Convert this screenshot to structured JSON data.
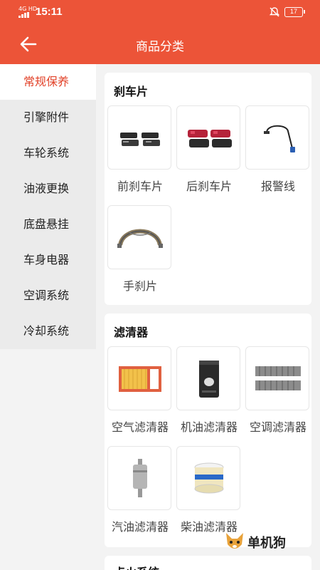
{
  "status_bar": {
    "network": "4G HD",
    "time": "15:11",
    "battery": "17"
  },
  "header": {
    "title": "商品分类",
    "back_icon": "arrow-left-icon"
  },
  "sidebar": {
    "items": [
      {
        "label": "常规保养",
        "active": true
      },
      {
        "label": "引擎附件",
        "active": false
      },
      {
        "label": "车轮系统",
        "active": false
      },
      {
        "label": "油液更换",
        "active": false
      },
      {
        "label": "底盘悬挂",
        "active": false
      },
      {
        "label": "车身电器",
        "active": false
      },
      {
        "label": "空调系统",
        "active": false
      },
      {
        "label": "冷却系统",
        "active": false
      }
    ]
  },
  "sections": [
    {
      "title": "刹车片",
      "items": [
        {
          "label": "前刹车片",
          "icon": "front-brake-pad-icon"
        },
        {
          "label": "后刹车片",
          "icon": "rear-brake-pad-icon"
        },
        {
          "label": "报警线",
          "icon": "alarm-wire-icon"
        },
        {
          "label": "手刹片",
          "icon": "handbrake-shoe-icon"
        }
      ]
    },
    {
      "title": "滤清器",
      "items": [
        {
          "label": "空气滤清器",
          "icon": "air-filter-icon"
        },
        {
          "label": "机油滤清器",
          "icon": "oil-filter-icon"
        },
        {
          "label": "空调滤清器",
          "icon": "cabin-filter-icon"
        },
        {
          "label": "汽油滤清器",
          "icon": "fuel-filter-icon"
        },
        {
          "label": "柴油滤清器",
          "icon": "diesel-filter-icon"
        }
      ]
    },
    {
      "title": "点火系统",
      "items": []
    }
  ],
  "watermark": {
    "text": "单机狗"
  },
  "colors": {
    "accent": "#ec5438",
    "active_text": "#e2432a",
    "sidebar_bg": "#ebebeb",
    "page_bg": "#f3f3f3"
  }
}
